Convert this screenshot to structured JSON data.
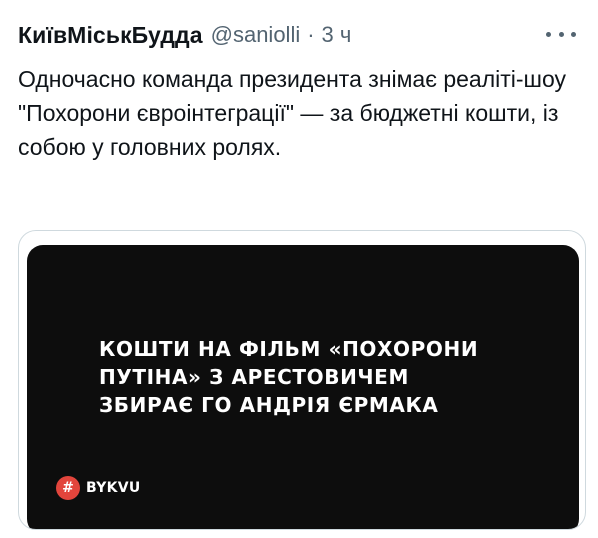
{
  "tweet": {
    "author_name": "КиївМіськБудда",
    "handle": "@saniolli",
    "separator": "·",
    "time": "3 ч",
    "more_icon": "more-horizontal-icon",
    "text": "Одночасно команда президента знімає реаліті-шоу \"Похорони євроінтеграції\" — за бюджетні кошти, із собою у головних ролях."
  },
  "media": {
    "headline_lines": [
      "КОШТИ НА ФІЛЬМ «ПОХОРОНИ",
      "ПУТІНА» З АРЕСТОВИЧЕМ",
      "ЗБИРАЄ ГО АНДРІЯ ЄРМАКА"
    ],
    "brand_symbol": "#",
    "brand_name": "BYKVU",
    "colors": {
      "background": "#0d0d0d",
      "brand_badge": "#e2453c",
      "text": "#ffffff"
    }
  },
  "colors": {
    "primary_text": "#0f1419",
    "secondary_text": "#536471",
    "card_border": "#cfd9de"
  }
}
